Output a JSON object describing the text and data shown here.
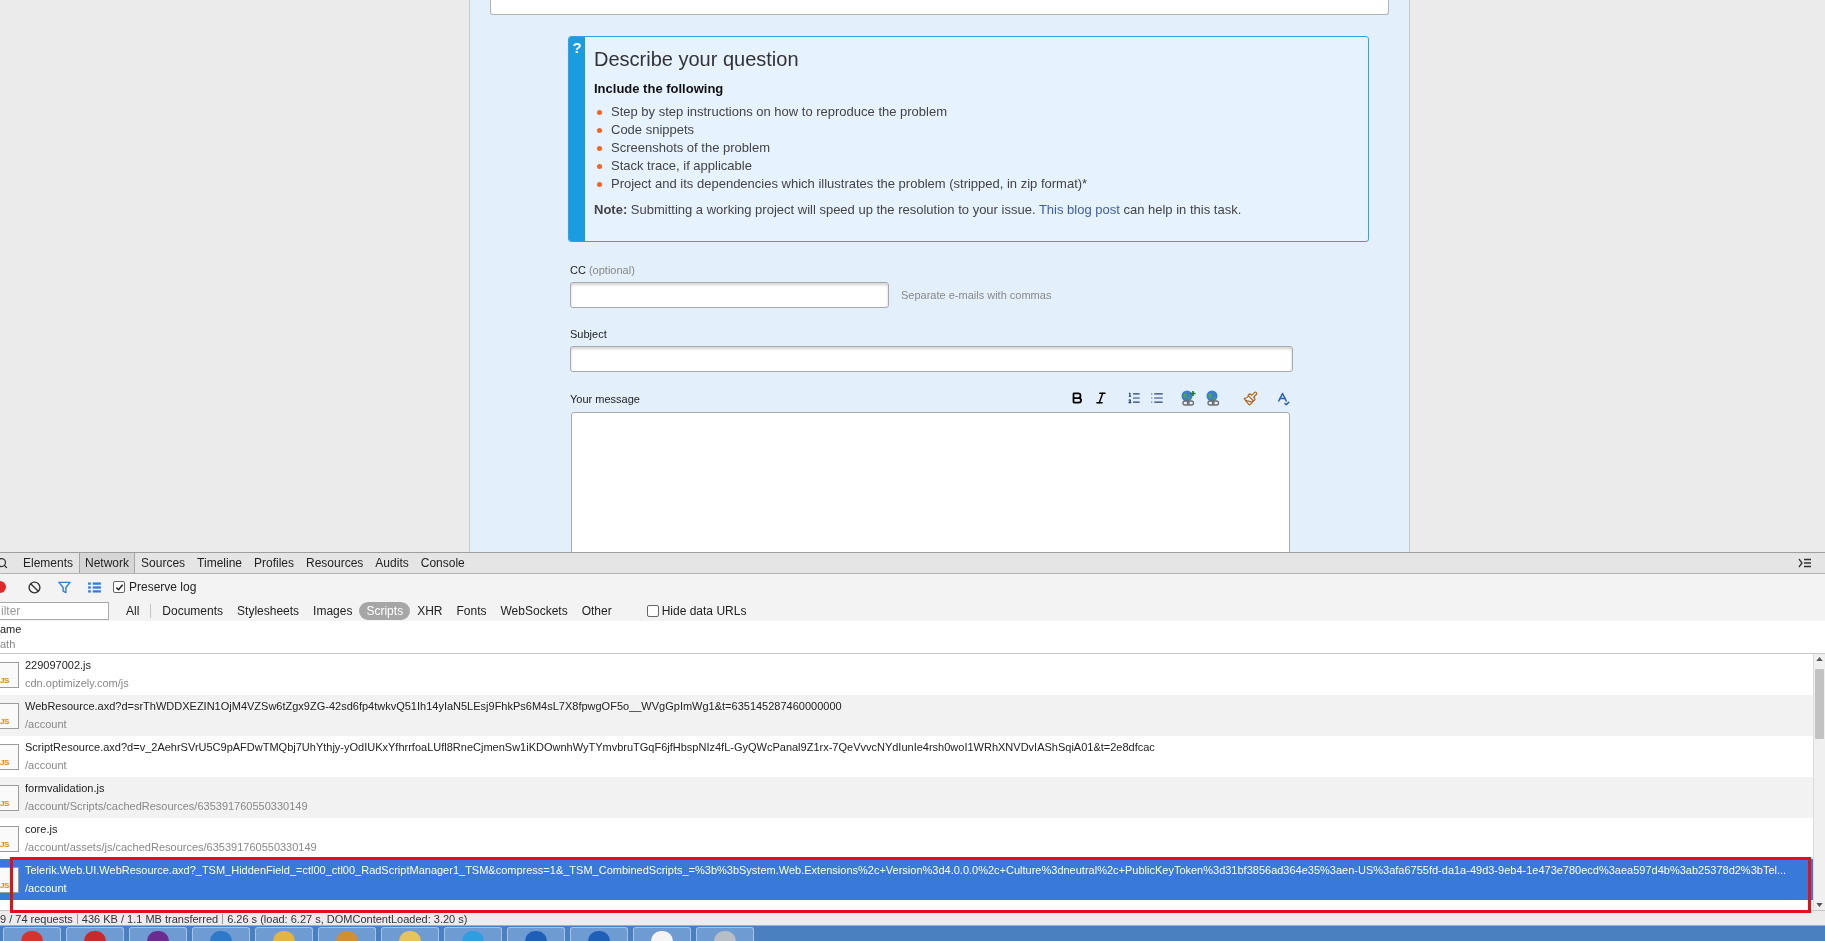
{
  "page": {
    "help_box": {
      "badge": "?",
      "title": "Describe your question",
      "subtitle": "Include the following",
      "items": [
        "Step by step instructions on how to reproduce the problem",
        "Code snippets",
        "Screenshots of the problem",
        "Stack trace, if applicable",
        "Project and its dependencies which illustrates the problem (stripped, in zip format)*"
      ],
      "note": {
        "text": "**Note:** Submitting a working project will speed up the resolution to your issue.",
        "link": "This blog post",
        "after": "can help in this task."
      }
    },
    "form": {
      "cc": {
        "label": "CC",
        "optional": "(optional)",
        "hint": "Separate e-mails with commas"
      },
      "subject": {
        "label": "Subject"
      },
      "message": {
        "label": "Your message"
      }
    }
  },
  "devtools": {
    "tabs": [
      {
        "label": "Elements",
        "selected": false
      },
      {
        "label": "Network",
        "selected": true
      },
      {
        "label": "Sources",
        "selected": false
      },
      {
        "label": "Timeline",
        "selected": false
      },
      {
        "label": "Profiles",
        "selected": false
      },
      {
        "label": "Resources",
        "selected": false
      },
      {
        "label": "Audits",
        "selected": false
      },
      {
        "label": "Console",
        "selected": false
      }
    ],
    "preserve_log": {
      "label": "Preserve log",
      "checked": true
    },
    "filter": {
      "placeholder": "ilter"
    },
    "type_filters": [
      {
        "label": "All",
        "selected": false
      },
      {
        "label": "Documents",
        "selected": false
      },
      {
        "label": "Stylesheets",
        "selected": false
      },
      {
        "label": "Images",
        "selected": false
      },
      {
        "label": "Scripts",
        "selected": true
      },
      {
        "label": "XHR",
        "selected": false
      },
      {
        "label": "Fonts",
        "selected": false
      },
      {
        "label": "WebSockets",
        "selected": false
      },
      {
        "label": "Other",
        "selected": false
      }
    ],
    "hide_data_urls": {
      "label": "Hide data URLs",
      "checked": false
    },
    "columns": {
      "name": "ame",
      "path": "ath"
    },
    "requests": [
      {
        "icon_text": "JS",
        "name": "229097002.js",
        "path": "cdn.optimizely.com/js",
        "selected": false
      },
      {
        "icon_text": "JS",
        "name": "WebResource.axd?d=srThWDDXEZIN1OjM4VZSw6tZgx9ZG-42sd6fp4twkvQ51Ih14yIaN5LEsj9FhkPs6M4sL7X8fpwgOF5o__WVgGpImWg1&t=635145287460000000",
        "path": "/account",
        "selected": false
      },
      {
        "icon_text": "JS",
        "name": "ScriptResource.axd?d=v_2AehrSVrU5C9pAFDwTMQbj7UhYthjy-yOdIUKxYfhrrfoaLUfl8RneCjmenSw1iKDOwnhWyTYmvbruTGqF6jfHbspNIz4fL-GyQWcPanal9Z1rx-7QeVvvcNYdIunIe4rsh0woI1WRhXNVDvIAShSqiA01&t=2e8dfcac",
        "path": "/account",
        "selected": false
      },
      {
        "icon_text": "JS",
        "name": "formvalidation.js",
        "path": "/account/Scripts/cachedResources/635391760550330149",
        "selected": false
      },
      {
        "icon_text": "JS",
        "name": "core.js",
        "path": "/account/assets/js/cachedResources/635391760550330149",
        "selected": false
      },
      {
        "icon_text": "JS",
        "name": "Telerik.Web.UI.WebResource.axd?_TSM_HiddenField_=ctl00_ctl00_RadScriptManager1_TSM&compress=1&_TSM_CombinedScripts_=%3b%3bSystem.Web.Extensions%2c+Version%3d4.0.0.0%2c+Culture%3dneutral%2c+PublicKeyToken%3d31bf3856ad364e35%3aen-US%3afa6755fd-da1a-49d3-9eb4-1e473e780ecd%3aea597d4b%3ab25378d2%3bTel...",
        "path": "/account",
        "selected": true
      }
    ],
    "status_bar": [
      "9 / 74 requests",
      "436 KB / 1.1 MB transferred",
      "6.26 s (load: 6.27 s, DOMContentLoaded: 3.20 s)"
    ]
  },
  "taskbar": {
    "apps": [
      {
        "color": "#d5332c"
      },
      {
        "color": "#c62a2a"
      },
      {
        "color": "#6b2c8f"
      },
      {
        "color": "#2f79c9"
      },
      {
        "color": "#e2b443"
      },
      {
        "color": "#d08f35"
      },
      {
        "color": "#e6c35b"
      },
      {
        "color": "#2f9ee0"
      },
      {
        "color": "#1f5fb8"
      },
      {
        "color": "#1f5fb8"
      },
      {
        "color": "#f4f4f4"
      },
      {
        "color": "#b8bec6"
      }
    ]
  }
}
